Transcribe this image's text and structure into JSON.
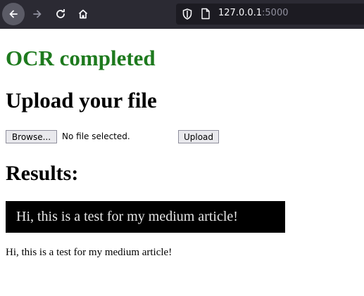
{
  "browser": {
    "url_host": "127.0.0.1",
    "url_port": ":5000"
  },
  "page": {
    "status": "OCR completed",
    "upload_heading": "Upload your file",
    "file_input": {
      "browse_label": "Browse...",
      "status": "No file selected."
    },
    "upload_button": "Upload",
    "results_heading": "Results:",
    "result_image_text": "Hi, this is a test for my medium article!",
    "result_text": "Hi, this is a test for my medium article!"
  },
  "colors": {
    "status_green": "#1e7a1e",
    "toolbar": "#2b2a33",
    "urlbar": "#1c1b22"
  }
}
